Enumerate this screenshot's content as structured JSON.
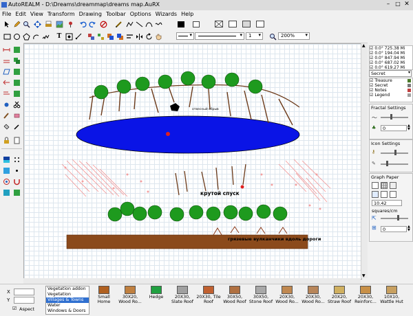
{
  "window": {
    "title": "AutoREALM - D:\\Dreams\\dreammap\\dreams map.AuRX"
  },
  "menu": [
    "File",
    "Edit",
    "View",
    "Transform",
    "Drawing",
    "Toolbar",
    "Options",
    "Wizards",
    "Help"
  ],
  "toolbar": {
    "line_width_value": "1",
    "zoom_value": "200%"
  },
  "right_panel": {
    "coords": [
      "0.0°  725.38 Mi",
      "0.0°  194.04 Mi",
      "0.0°  847.94 Mi",
      "0.0°  687.02 Mi",
      "0.0°  619.27 Mi"
    ],
    "overlay_select": "Secret",
    "overlays": [
      {
        "label": "Treasure",
        "color": "#4a7a2a"
      },
      {
        "label": "Secret",
        "color": "#7a7a7a"
      },
      {
        "label": "Notes",
        "color": "#c04040"
      },
      {
        "label": "Legend",
        "color": "#a0a0a0"
      }
    ],
    "fractal_title": "Fractal Settings",
    "fractal_value": "0",
    "icon_title": "Icon Settings",
    "graph_title": "Graph Paper",
    "graph_value": "10.42",
    "graph_unit": "squares/cm",
    "graph_value2": "0"
  },
  "map": {
    "label_cliff": "отвесный обрыв",
    "label_descent": "крутой спуск",
    "label_volcanoes": "грязевые вулканчики вдоль дороги"
  },
  "bottom": {
    "x_label": "X",
    "y_label": "Y",
    "aspect_label": "Aspect",
    "categories": [
      "Vegetation addon",
      "Vegetation",
      "Villages & Towns",
      "Water",
      "Windows & Doors"
    ],
    "selected_category": 2,
    "symbols": [
      {
        "label": "Small Home",
        "color": "#b06020"
      },
      {
        "label": "30X20, Wood Ro...",
        "color": "#c08040"
      },
      {
        "label": "Hedge",
        "color": "#20a040"
      },
      {
        "label": "20X30, Slate Roof",
        "color": "#a0a0a0"
      },
      {
        "label": "20X30, Tile Roof",
        "color": "#c06030"
      },
      {
        "label": "30X50, Wood Roof",
        "color": "#b07040"
      },
      {
        "label": "30X50, Stone Roof",
        "color": "#a8a8a8"
      },
      {
        "label": "20X30, Wood Ro...",
        "color": "#c08850"
      },
      {
        "label": "20X30, Wood Ro...",
        "color": "#b8865a"
      },
      {
        "label": "20X20, Straw Roof",
        "color": "#d0b060"
      },
      {
        "label": "20X30, Reinforc...",
        "color": "#c89048"
      },
      {
        "label": "10X10, Wattle Hut",
        "color": "#c8a060"
      }
    ]
  }
}
